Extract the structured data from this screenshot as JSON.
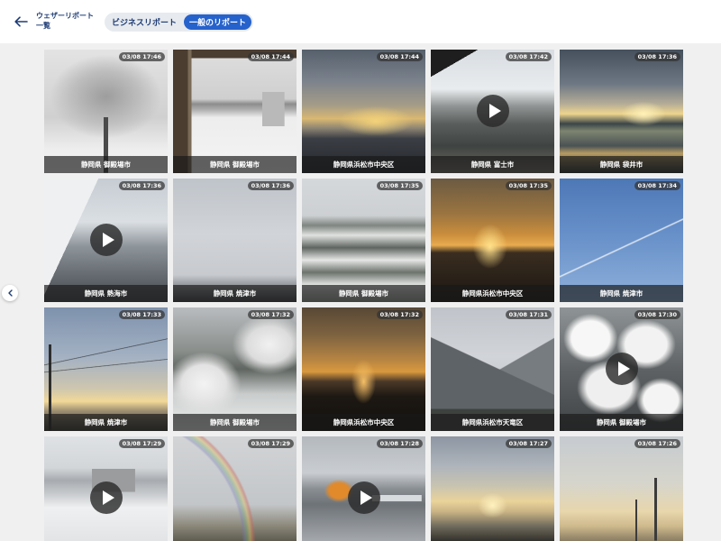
{
  "theme": {
    "accent": "#2662cc",
    "ink": "#1d3b74",
    "page_bg": "#f0f0f0"
  },
  "header": {
    "back_icon": "arrow-left-icon",
    "title_line1": "ウェザーリポート",
    "title_line2": "一覧",
    "tabs": [
      {
        "label": "ビジネスリポート",
        "active": false
      },
      {
        "label": "一般のリポート",
        "active": true
      }
    ]
  },
  "side_toggle": {
    "icon": "chevron-left-icon"
  },
  "reports": [
    {
      "time": "03/08 17:46",
      "location": "静岡県 御殿場市"
    },
    {
      "time": "03/08 17:44",
      "location": "静岡県 御殿場市"
    },
    {
      "time": "03/08 17:44",
      "location": "静岡県浜松市中央区"
    },
    {
      "time": "03/08 17:42",
      "location": "静岡県 富士市",
      "media_icon": "play-icon"
    },
    {
      "time": "03/08 17:36",
      "location": "静岡県 袋井市"
    },
    {
      "time": "03/08 17:36",
      "location": "静岡県 熱海市",
      "media_icon": "play-icon"
    },
    {
      "time": "03/08 17:36",
      "location": "静岡県 焼津市"
    },
    {
      "time": "03/08 17:35",
      "location": "静岡県 御殿場市"
    },
    {
      "time": "03/08 17:35",
      "location": "静岡県浜松市中央区"
    },
    {
      "time": "03/08 17:34",
      "location": "静岡県 焼津市"
    },
    {
      "time": "03/08 17:33",
      "location": "静岡県 焼津市"
    },
    {
      "time": "03/08 17:32",
      "location": "静岡県 御殿場市"
    },
    {
      "time": "03/08 17:32",
      "location": "静岡県浜松市中央区"
    },
    {
      "time": "03/08 17:31",
      "location": "静岡県浜松市天竜区"
    },
    {
      "time": "03/08 17:30",
      "location": "静岡県 御殿場市",
      "media_icon": "play-icon"
    },
    {
      "time": "03/08 17:29",
      "media_icon": "play-icon"
    },
    {
      "time": "03/08 17:29"
    },
    {
      "time": "03/08 17:28",
      "media_icon": "play-icon"
    },
    {
      "time": "03/08 17:27"
    },
    {
      "time": "03/08 17:26"
    }
  ]
}
